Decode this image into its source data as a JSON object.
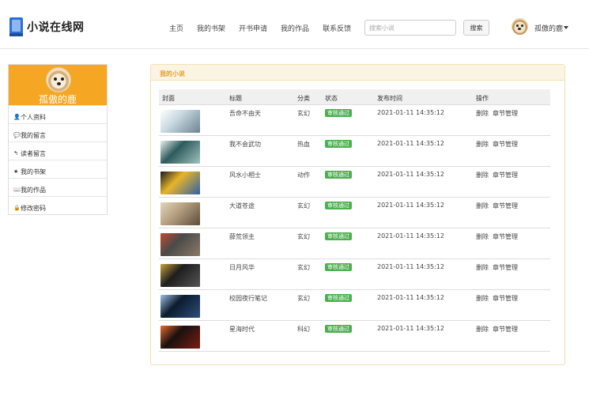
{
  "site": {
    "title": "小说在线网"
  },
  "nav": [
    "主页",
    "我的书架",
    "开书申请",
    "我的作品",
    "联系反馈"
  ],
  "search": {
    "placeholder": "搜索小说",
    "button": "搜索"
  },
  "user": {
    "name": "孤傲的鹿"
  },
  "sidebar": {
    "name": "孤傲的鹿",
    "items": [
      {
        "icon": "user-icon",
        "glyph": "👤",
        "label": "个人资料"
      },
      {
        "icon": "comment-icon",
        "glyph": "💬",
        "label": "我的留言"
      },
      {
        "icon": "reply-icon",
        "glyph": "↰",
        "label": "读者留言"
      },
      {
        "icon": "star-icon",
        "glyph": "★",
        "label": "我的书架"
      },
      {
        "icon": "book-icon",
        "glyph": "📖",
        "label": "我的作品"
      },
      {
        "icon": "lock-icon",
        "glyph": "🔒",
        "label": "修改密码"
      }
    ]
  },
  "panel": {
    "title": "我的小说",
    "columns": [
      "封面",
      "标题",
      "分类",
      "状态",
      "发布时间",
      "操作"
    ],
    "rows": [
      {
        "title": "吾命不由天",
        "category": "玄幻",
        "status": "审核通过",
        "time": "2021-01-11 14:35:12",
        "ops": [
          "删除",
          "章节管理"
        ],
        "cover_colors": [
          "#c9d8e0",
          "#6b8490",
          "#ffffff"
        ]
      },
      {
        "title": "我不会武功",
        "category": "热血",
        "status": "审核通过",
        "time": "2021-01-11 14:35:12",
        "ops": [
          "删除",
          "章节管理"
        ],
        "cover_colors": [
          "#2d5b5b",
          "#9fc2c0",
          "#e8f0ef"
        ]
      },
      {
        "title": "风水小相士",
        "category": "动作",
        "status": "审核通过",
        "time": "2021-01-11 14:35:12",
        "ops": [
          "删除",
          "章节管理"
        ],
        "cover_colors": [
          "#e8b52a",
          "#2f5fa8",
          "#1a1a1a"
        ]
      },
      {
        "title": "大道苍途",
        "category": "玄幻",
        "status": "审核通过",
        "time": "2021-01-11 14:35:12",
        "ops": [
          "删除",
          "章节管理"
        ],
        "cover_colors": [
          "#b8a383",
          "#5d4b3a",
          "#e3d5bd"
        ]
      },
      {
        "title": "薛荒领主",
        "category": "玄幻",
        "status": "审核通过",
        "time": "2021-01-11 14:35:12",
        "ops": [
          "删除",
          "章节管理"
        ],
        "cover_colors": [
          "#4a4a4a",
          "#8d7a66",
          "#c44a2e"
        ]
      },
      {
        "title": "日月风华",
        "category": "玄幻",
        "status": "审核通过",
        "time": "2021-01-11 14:35:12",
        "ops": [
          "删除",
          "章节管理"
        ],
        "cover_colors": [
          "#1e1e1e",
          "#555",
          "#c9a03a"
        ]
      },
      {
        "title": "校园夜行笔记",
        "category": "玄幻",
        "status": "审核通过",
        "time": "2021-01-11 14:35:12",
        "ops": [
          "删除",
          "章节管理"
        ],
        "cover_colors": [
          "#0c1b2e",
          "#2f4e7a",
          "#9ec0e6"
        ]
      },
      {
        "title": "星海时代",
        "category": "科幻",
        "status": "审核通过",
        "time": "2021-01-11 14:35:12",
        "ops": [
          "删除",
          "章节管理"
        ],
        "cover_colors": [
          "#1a1010",
          "#7a1f12",
          "#e76a2a"
        ]
      }
    ]
  },
  "colors": {
    "accent": "#f5a623",
    "badge": "#4caf50",
    "panel_head_text": "#e0a030"
  }
}
